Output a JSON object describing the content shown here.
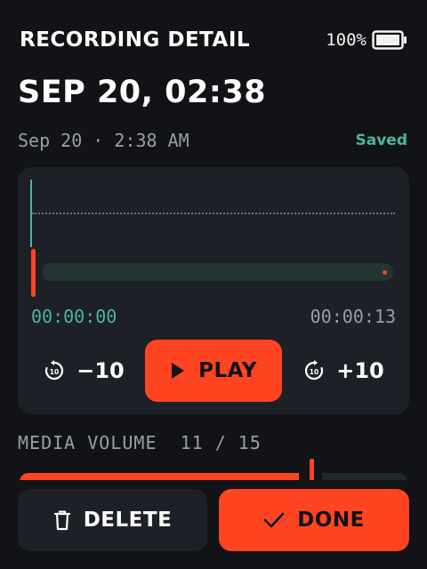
{
  "header": {
    "title": "RECORDING DETAIL",
    "battery_percent": "100%"
  },
  "recording": {
    "title": "SEP 20, 02:38",
    "timestamp": "Sep 20 · 2:38 AM",
    "status": "Saved",
    "current_time": "00:00:00",
    "total_time": "00:00:13",
    "playback_progress": 0.0
  },
  "controls": {
    "rewind_label": "−10",
    "play_label": "PLAY",
    "forward_label": "+10",
    "rewind_icon": "replay-10-icon",
    "forward_icon": "forward-10-icon",
    "play_icon": "play-icon"
  },
  "volume": {
    "label": "MEDIA VOLUME  11 / 15",
    "value": 11,
    "max": 15
  },
  "actions": {
    "delete_label": "DELETE",
    "done_label": "DONE",
    "delete_icon": "trash-icon",
    "done_icon": "check-icon"
  },
  "colors": {
    "accent": "#ff4422",
    "teal": "#4fb3a0",
    "card": "#1d2027",
    "background": "#121316"
  }
}
